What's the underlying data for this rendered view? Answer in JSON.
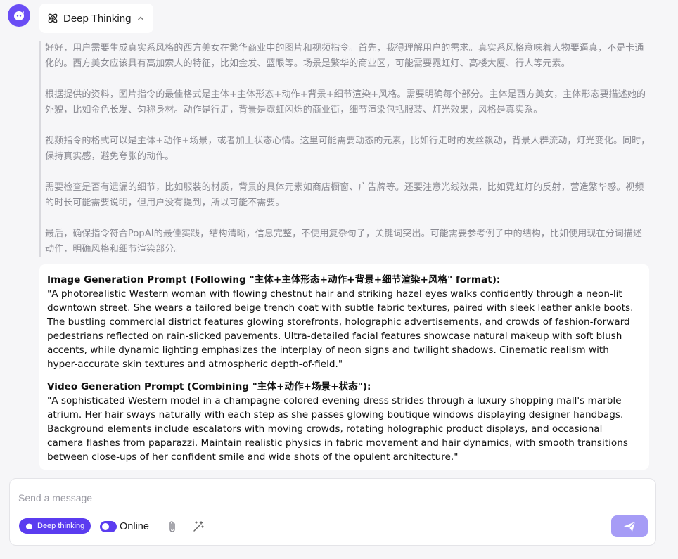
{
  "header": {
    "mode_label": "Deep Thinking"
  },
  "thinking": {
    "paragraphs": [
      "好好，用户需要生成真实系风格的西方美女在繁华商业中的图片和视频指令。首先，我得理解用户的需求。真实系风格意味着人物要逼真，不是卡通化的。西方美女应该具有高加索人的特征，比如金发、蓝眼等。场景是繁华的商业区，可能需要霓虹灯、高楼大厦、行人等元素。",
      "根据提供的资料，图片指令的最佳格式是主体+主体形态+动作+背景+细节渲染+风格。需要明确每个部分。主体是西方美女，主体形态要描述她的外貌，比如金色长发、匀称身材。动作是行走，背景是霓虹闪烁的商业街，细节渲染包括服装、灯光效果，风格是真实系。",
      "视频指令的格式可以是主体+动作+场景，或者加上状态心情。这里可能需要动态的元素，比如行走时的发丝飘动，背景人群流动，灯光变化。同时，保持真实感，避免夸张的动作。",
      "需要检查是否有遗漏的细节，比如服装的材质，背景的具体元素如商店橱窗、广告牌等。还要注意光线效果，比如霓虹灯的反射，营造繁华感。视频的时长可能需要说明，但用户没有提到，所以可能不需要。",
      "最后，确保指令符合PopAI的最佳实践，结构清晰，信息完整，不使用复杂句子，关键词突出。可能需要参考例子中的结构，比如使用现在分词描述动作，明确风格和细节渲染部分。"
    ]
  },
  "answer": {
    "image_heading": "Image Generation Prompt (Following \"主体+主体形态+动作+背景+细节渲染+风格\" format):",
    "image_text": "\"A photorealistic Western woman with flowing chestnut hair and striking hazel eyes walks confidently through a neon-lit downtown street. She wears a tailored beige trench coat with subtle fabric textures, paired with sleek leather ankle boots. The bustling commercial district features glowing storefronts, holographic advertisements, and crowds of fashion-forward pedestrians reflected on rain-slicked pavements. Ultra-detailed facial features showcase natural makeup with soft blush accents, while dynamic lighting emphasizes the interplay of neon signs and twilight shadows. Cinematic realism with hyper-accurate skin textures and atmospheric depth-of-field.\"",
    "video_heading": "Video Generation Prompt (Combining \"主体+动作+场景+状态\"):",
    "video_text": "\"A sophisticated Western model in a champagne-colored evening dress strides through a luxury shopping mall's marble atrium. Her hair sways naturally with each step as she passes glowing boutique windows displaying designer handbags. Background elements include escalators with moving crowds, rotating holographic product displays, and occasional camera flashes from paparazzi. Maintain realistic physics in fabric movement and hair dynamics, with smooth transitions between close-ups of her confident smile and wide shots of the opulent architecture.\""
  },
  "composer": {
    "placeholder": "Send a message",
    "deep_thinking_label": "Deep thinking",
    "online_label": "Online"
  },
  "colors": {
    "accent": "#5b3cf0",
    "send_button": "#a69cf6",
    "thinking_text": "#8a8a92"
  },
  "icons": {
    "avatar": "bot-logo-icon",
    "mode": "atom-icon",
    "collapse": "chevron-up-icon",
    "attach": "paperclip-icon",
    "magic": "magic-wand-icon",
    "send": "paper-plane-icon"
  }
}
